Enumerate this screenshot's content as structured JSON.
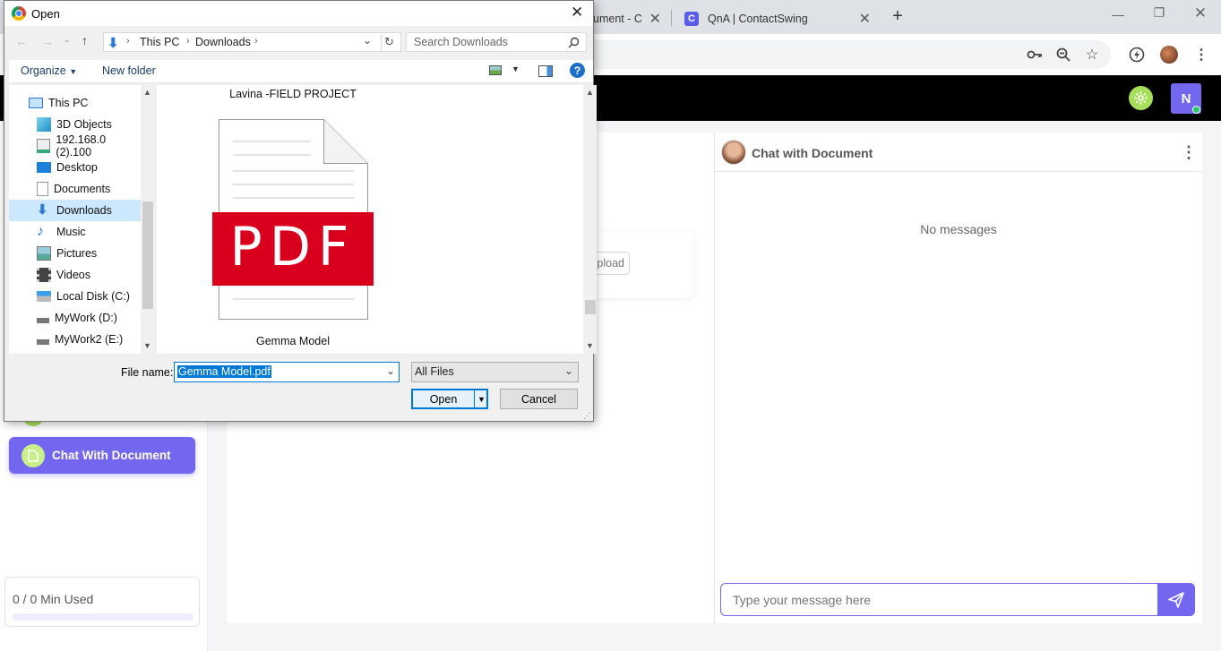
{
  "browser": {
    "tabs": [
      {
        "title": "ument - C",
        "active": false
      },
      {
        "title": "QnA | ContactSwing",
        "active": true
      }
    ],
    "new_tab_symbol": "+"
  },
  "app": {
    "brand_color": "#7367f0",
    "avatar_letter": "N",
    "sidebar": {
      "chat_button_label": "Chat With Document",
      "usage_text": "0 / 0 Min Used",
      "usage_progress": 0
    },
    "main": {
      "upload_label": "Upload"
    },
    "chat": {
      "title": "Chat with Document",
      "empty_text": "No messages",
      "input_placeholder": "Type your message here"
    }
  },
  "dialog": {
    "title": "Open",
    "breadcrumb": [
      "This PC",
      "Downloads"
    ],
    "search_placeholder": "Search Downloads",
    "organize_label": "Organize",
    "new_folder_label": "New folder",
    "nav_items": [
      {
        "label": "This PC",
        "icon": "computer-icon",
        "indent": 0
      },
      {
        "label": "3D Objects",
        "icon": "cube-icon",
        "indent": 1
      },
      {
        "label": "192.168.0 (2).100",
        "icon": "network-drive-icon",
        "indent": 1
      },
      {
        "label": "Desktop",
        "icon": "desktop-icon",
        "indent": 1
      },
      {
        "label": "Documents",
        "icon": "documents-icon",
        "indent": 1
      },
      {
        "label": "Downloads",
        "icon": "download-arrow-icon",
        "indent": 1,
        "selected": true
      },
      {
        "label": "Music",
        "icon": "music-note-icon",
        "indent": 1
      },
      {
        "label": "Pictures",
        "icon": "pictures-icon",
        "indent": 1
      },
      {
        "label": "Videos",
        "icon": "film-icon",
        "indent": 1
      },
      {
        "label": "Local Disk (C:)",
        "icon": "disk-icon",
        "indent": 1
      },
      {
        "label": "MyWork (D:)",
        "icon": "drive-icon",
        "indent": 1
      },
      {
        "label": "MyWork2 (E:)",
        "icon": "drive-icon",
        "indent": 1
      }
    ],
    "files": [
      {
        "name": "Lavina -FIELD PROJECT"
      },
      {
        "name": "Gemma Model",
        "thumb_text": "PDF"
      }
    ],
    "filename_label": "File name:",
    "filename_value": "Gemma Model.pdf",
    "filetype_value": "All Files",
    "open_label": "Open",
    "cancel_label": "Cancel"
  }
}
